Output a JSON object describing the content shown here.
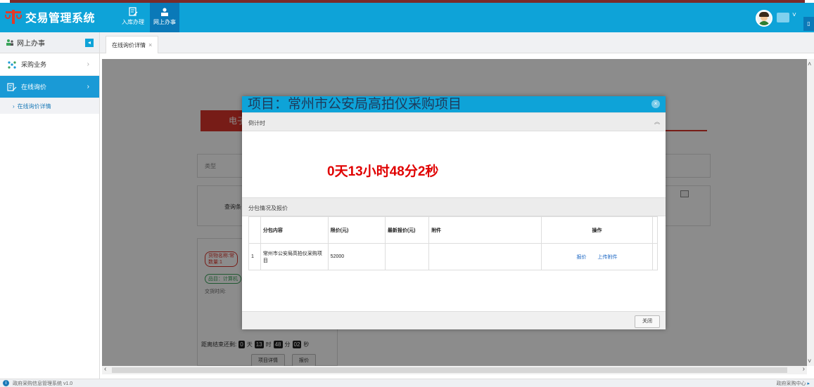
{
  "header": {
    "app_title": "交易管理系统",
    "nav": [
      {
        "label": "入库办理"
      },
      {
        "label": "网上办事"
      }
    ]
  },
  "sidebar": {
    "title": "网上办事",
    "items": [
      {
        "label": "采购业务"
      },
      {
        "label": "在线询价"
      }
    ],
    "sub_items": [
      {
        "label": "在线询价详情"
      }
    ]
  },
  "tabs": [
    {
      "label": "在线询价详情",
      "close": "×"
    }
  ],
  "background_page": {
    "red_tab_text": "电子",
    "type_label": "类型",
    "query_label": "查询条",
    "card_pill1_line1": "货物名称:常",
    "card_pill1_line2": "数量:1",
    "card_pill2": "品目：计算机",
    "card_time": "交货时间:",
    "countdown_prefix": "距离结束还剩:",
    "cd_days": "0",
    "cd_days_unit": "天",
    "cd_hours": "13",
    "cd_hours_unit": "时",
    "cd_mins": "48",
    "cd_mins_unit": "分",
    "cd_secs": "02",
    "cd_secs_unit": "秒",
    "btn_detail": "项目详情",
    "btn_quote": "报价"
  },
  "modal": {
    "title": "项目：常州市公安局高拍仪采购项目",
    "close_icon": "×",
    "countdown_section": "倒计时",
    "countdown_value": "0天13小时48分2秒",
    "package_section": "分包情况及报价",
    "table": {
      "headers": [
        "",
        "分包内容",
        "限价(元)",
        "最新报价(元)",
        "附件",
        "操作"
      ],
      "rows": [
        {
          "index": "1",
          "content": "常州市公安局高拍仪采购项目",
          "limit_price": "52000",
          "latest_quote": "",
          "attachment": "",
          "actions": [
            "报价",
            "上传附件"
          ]
        }
      ]
    },
    "close_button": "关闭"
  },
  "statusbar": {
    "version": "政府采购信息管理系统 v1.0",
    "right": "政府采购中心"
  },
  "colors": {
    "header_blue": "#0ea3d8",
    "active_nav": "#0a79b8",
    "countdown_red": "#e00000",
    "accent_red": "#d9342b",
    "link_blue": "#1a66c4"
  }
}
